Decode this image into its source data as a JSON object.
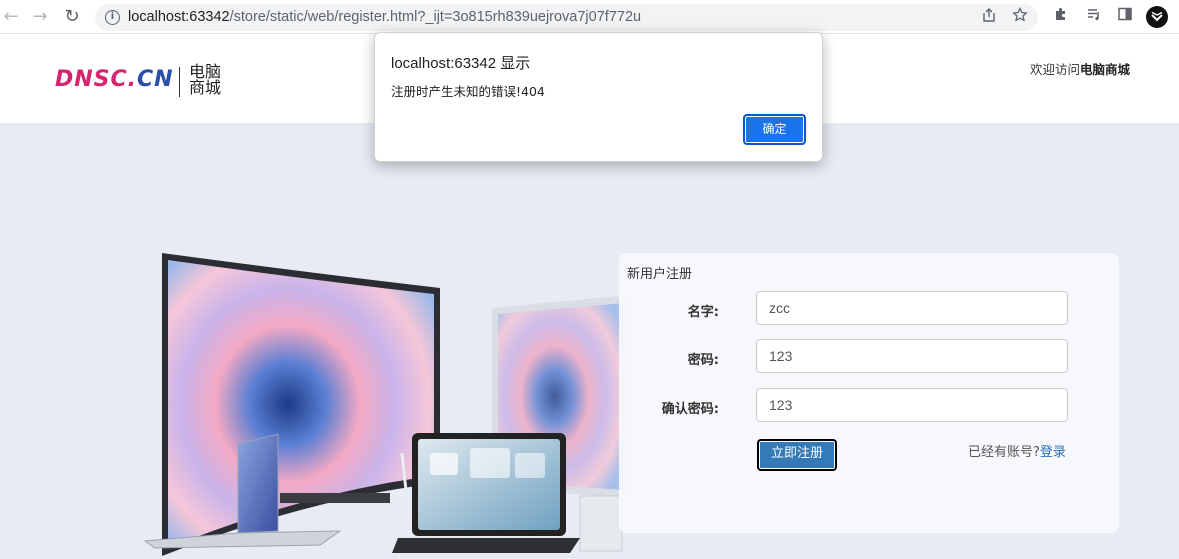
{
  "browser": {
    "url_host": "localhost:63342",
    "url_path": "/store/static/web/register.html?_ijt=3o815rh839uejrova7j07f772u",
    "back_glyph": "←",
    "forward_glyph": "→",
    "reload_glyph": "↻",
    "info_glyph": "i"
  },
  "header": {
    "logo_en_part1": "DNSC.",
    "logo_en_part2": "CN",
    "logo_cn_line1": "电脑",
    "logo_cn_line2": "商城",
    "welcome_prefix": "欢迎访问",
    "welcome_name": "电脑商城"
  },
  "register": {
    "title": "新用户注册",
    "name_label": "名字:",
    "name_value": "zcc",
    "password_label": "密码:",
    "password_value": "123",
    "confirm_label": "确认密码:",
    "confirm_value": "123",
    "submit_label": "立即注册",
    "have_account": "已经有账号?",
    "login_link": "登录"
  },
  "dialog": {
    "title": "localhost:63342 显示",
    "message": "注册时产生未知的错误!404",
    "ok_label": "确定"
  },
  "colors": {
    "page_bg": "#e7ebf3",
    "primary": "#337ab7",
    "dialog_ok": "#1a73e8",
    "logo_pink": "#d6246e",
    "logo_blue": "#2a4fa8"
  }
}
